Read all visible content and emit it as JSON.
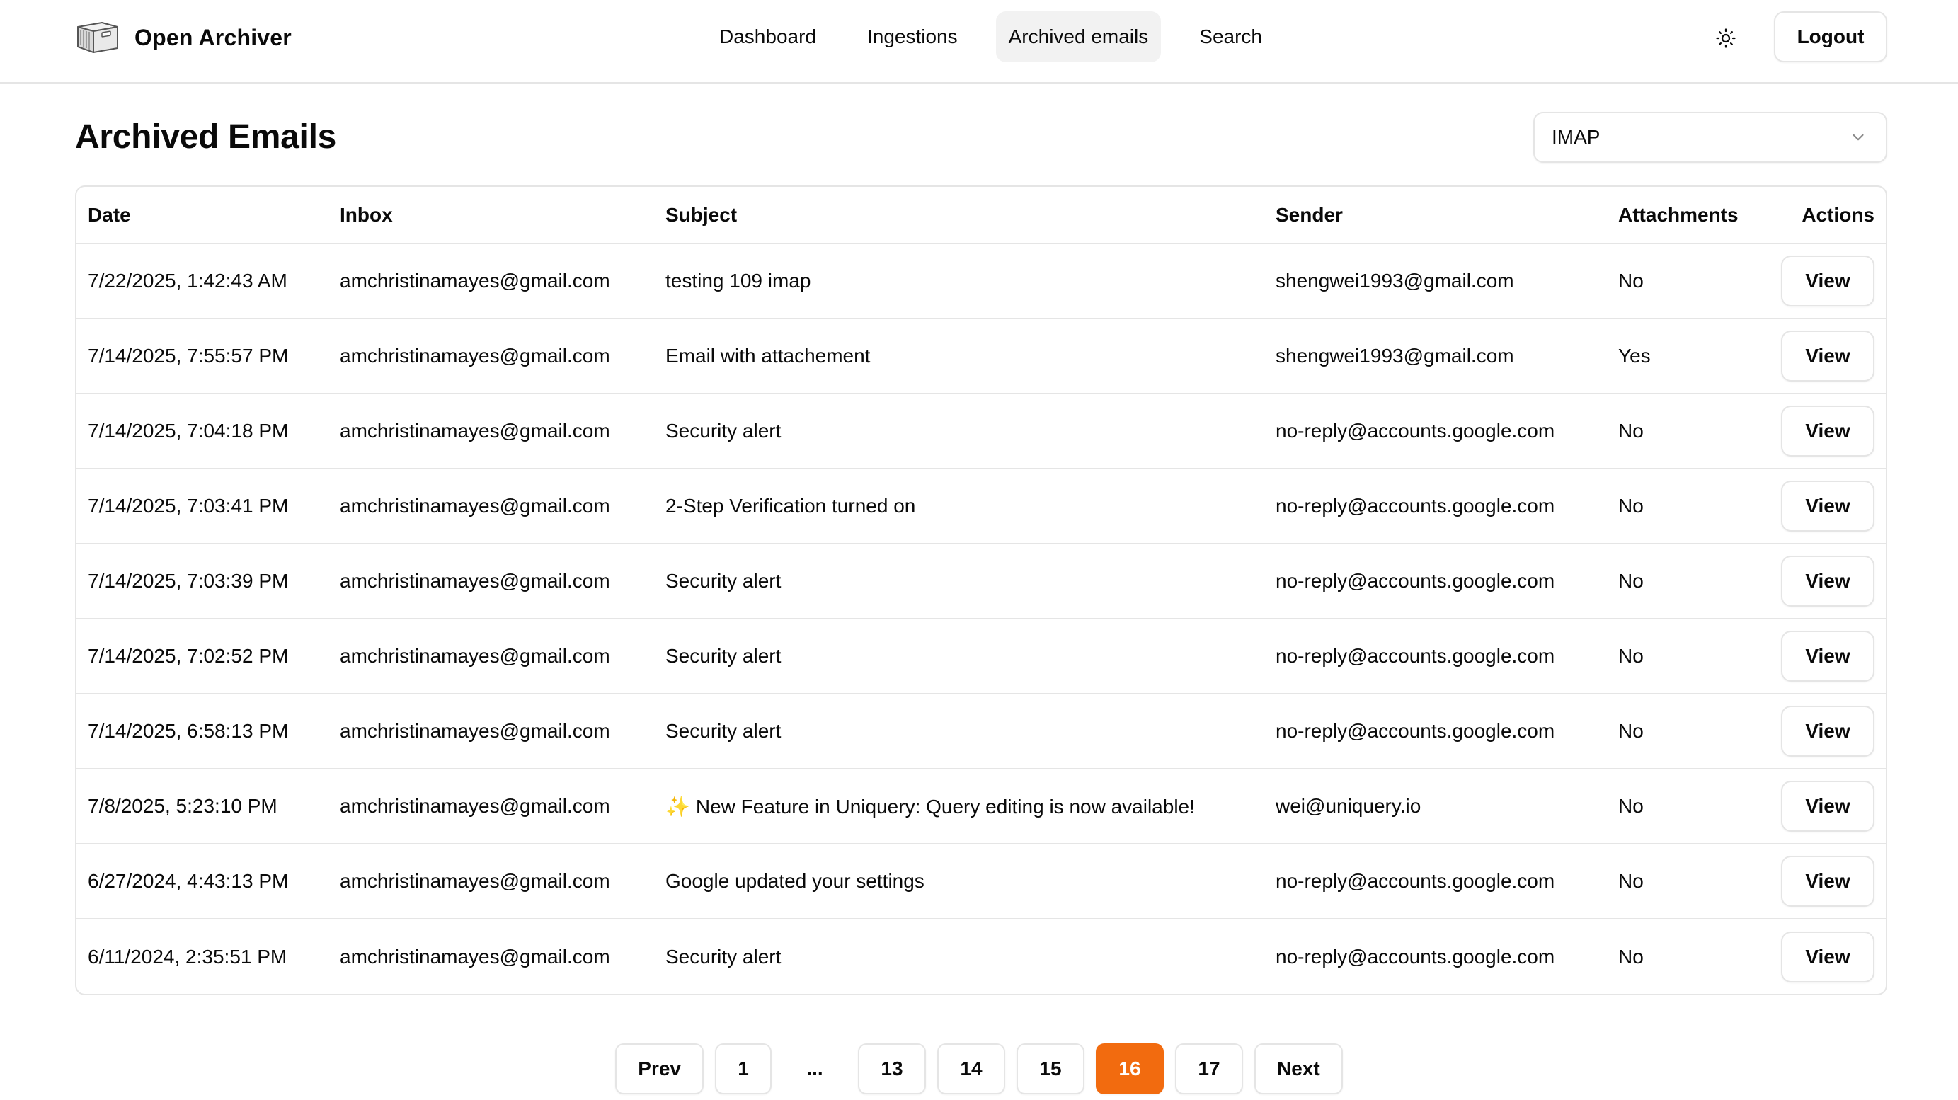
{
  "app": {
    "name": "Open Archiver",
    "nav": [
      "Dashboard",
      "Ingestions",
      "Archived emails",
      "Search"
    ],
    "active_nav": "Archived emails",
    "logout_label": "Logout"
  },
  "page": {
    "title": "Archived Emails",
    "source_select": {
      "value": "IMAP"
    }
  },
  "table": {
    "headers": {
      "date": "Date",
      "inbox": "Inbox",
      "subject": "Subject",
      "sender": "Sender",
      "attachments": "Attachments",
      "actions": "Actions"
    },
    "view_label": "View",
    "rows": [
      {
        "date": "7/22/2025, 1:42:43 AM",
        "inbox": "amchristinamayes@gmail.com",
        "subject": "testing 109 imap",
        "sender": "shengwei1993@gmail.com",
        "attachments": "No"
      },
      {
        "date": "7/14/2025, 7:55:57 PM",
        "inbox": "amchristinamayes@gmail.com",
        "subject": "Email with attachement",
        "sender": "shengwei1993@gmail.com",
        "attachments": "Yes"
      },
      {
        "date": "7/14/2025, 7:04:18 PM",
        "inbox": "amchristinamayes@gmail.com",
        "subject": "Security alert",
        "sender": "no-reply@accounts.google.com",
        "attachments": "No"
      },
      {
        "date": "7/14/2025, 7:03:41 PM",
        "inbox": "amchristinamayes@gmail.com",
        "subject": "2-Step Verification turned on",
        "sender": "no-reply@accounts.google.com",
        "attachments": "No"
      },
      {
        "date": "7/14/2025, 7:03:39 PM",
        "inbox": "amchristinamayes@gmail.com",
        "subject": "Security alert",
        "sender": "no-reply@accounts.google.com",
        "attachments": "No"
      },
      {
        "date": "7/14/2025, 7:02:52 PM",
        "inbox": "amchristinamayes@gmail.com",
        "subject": "Security alert",
        "sender": "no-reply@accounts.google.com",
        "attachments": "No"
      },
      {
        "date": "7/14/2025, 6:58:13 PM",
        "inbox": "amchristinamayes@gmail.com",
        "subject": "Security alert",
        "sender": "no-reply@accounts.google.com",
        "attachments": "No"
      },
      {
        "date": "7/8/2025, 5:23:10 PM",
        "inbox": "amchristinamayes@gmail.com",
        "subject": "New Feature in Uniquery: Query editing is now available!",
        "subject_icon": "sparkle-icon",
        "sender": "wei@uniquery.io",
        "attachments": "No"
      },
      {
        "date": "6/27/2024, 4:43:13 PM",
        "inbox": "amchristinamayes@gmail.com",
        "subject": "Google updated your settings",
        "sender": "no-reply@accounts.google.com",
        "attachments": "No"
      },
      {
        "date": "6/11/2024, 2:35:51 PM",
        "inbox": "amchristinamayes@gmail.com",
        "subject": "Security alert",
        "sender": "no-reply@accounts.google.com",
        "attachments": "No"
      }
    ]
  },
  "pagination": {
    "prev_label": "Prev",
    "next_label": "Next",
    "pages": [
      "1",
      "...",
      "13",
      "14",
      "15",
      "16",
      "17"
    ],
    "current": "16"
  },
  "icons": {
    "logo": "archive-box-icon",
    "theme_toggle": "sun-icon",
    "select_chevron": "chevron-down-icon"
  },
  "colors": {
    "accent": "#f26b0f",
    "border": "#e5e5e5",
    "nav_active_bg": "#f2f2f2",
    "sparkle": "#f5c518"
  }
}
